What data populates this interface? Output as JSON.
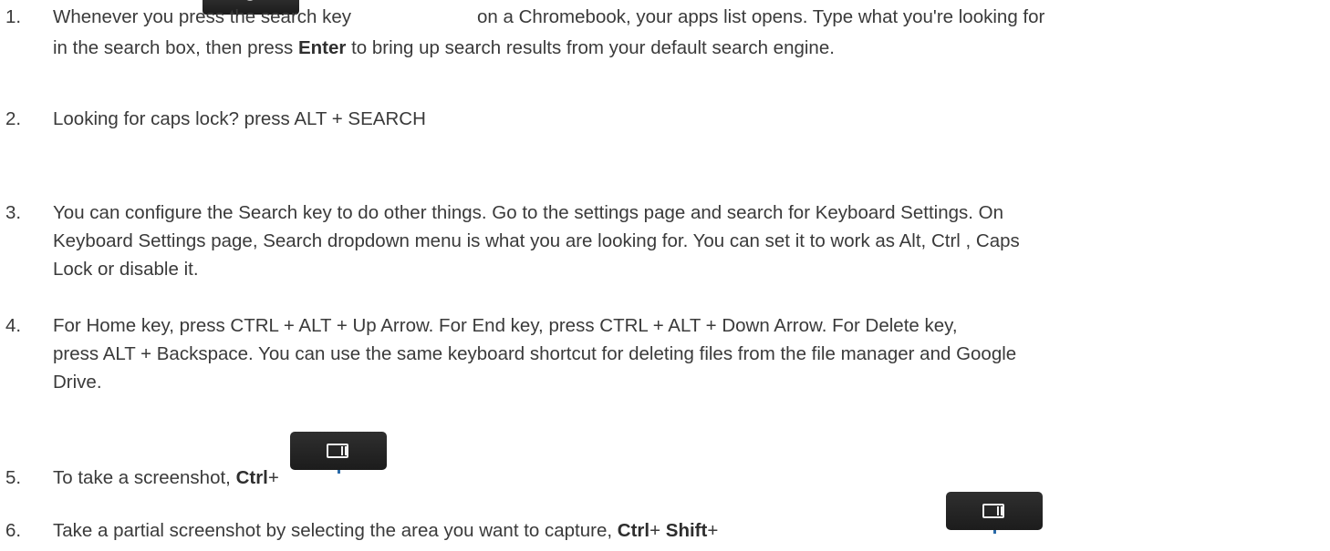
{
  "tips": [
    {
      "number": "1.",
      "line1_before": "Whenever you press the search key",
      "line1_after": "on a Chromebook, your apps list opens. Type what you're looking for",
      "line2_before": "in the search box, then press",
      "line2_bold": "Enter",
      "line2_after": "to bring up search results from your default search engine.",
      "key_icon": "search-key-icon"
    },
    {
      "number": "2.",
      "text": "Looking for caps  lock? press ALT + SEARCH"
    },
    {
      "number": "3.",
      "lines": [
        "You can configure the Search key to do other things. Go to the settings page and search for Keyboard Settings. On",
        "Keyboard Settings page, Search dropdown menu is what you are looking for. You can set it to work as Alt, Ctrl , Caps",
        "Lock or disable it."
      ]
    },
    {
      "number": "4.",
      "lines": [
        "For Home key, press  CTRL + ALT + Up Arrow. For End key, press CTRL + ALT + Down Arrow.  For Delete key,",
        "press ALT + Backspace. You can use the same keyboard shortcut for deleting files from the file manager and Google",
        "Drive."
      ]
    },
    {
      "number": "5.",
      "before": " To take a screenshot,",
      "bold": "Ctrl",
      "after": "+",
      "key_icon": "show-windows-key-icon"
    },
    {
      "number": "6.",
      "before": "Take a partial screenshot by selecting the area you want to capture,",
      "bold1": "Ctrl",
      "mid": "+",
      "bold2": "Shift",
      "after": "+",
      "key_icon": "show-windows-key-icon"
    }
  ],
  "colors": {
    "text": "#3a3a3a",
    "key": "#1f1f1f",
    "key_glyph": "#f2f2f2"
  }
}
